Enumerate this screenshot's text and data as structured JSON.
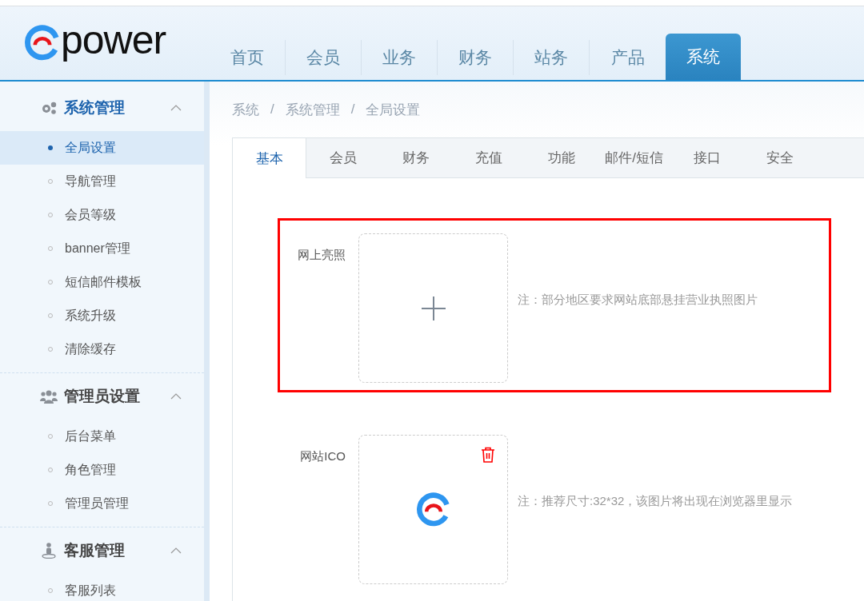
{
  "logo": {
    "text": "power"
  },
  "nav": [
    {
      "label": "首页",
      "selected": false
    },
    {
      "label": "会员",
      "selected": false
    },
    {
      "label": "业务",
      "selected": false
    },
    {
      "label": "财务",
      "selected": false
    },
    {
      "label": "站务",
      "selected": false
    },
    {
      "label": "产品",
      "selected": false
    },
    {
      "label": "系统",
      "selected": true
    }
  ],
  "sidebar": {
    "groups": [
      {
        "title": "系统管理",
        "selected": true,
        "expanded": true,
        "items": [
          {
            "label": "全局设置",
            "selected": true
          },
          {
            "label": "导航管理",
            "selected": false
          },
          {
            "label": "会员等级",
            "selected": false
          },
          {
            "label": "banner管理",
            "selected": false
          },
          {
            "label": "短信邮件模板",
            "selected": false
          },
          {
            "label": "系统升级",
            "selected": false
          },
          {
            "label": "清除缓存",
            "selected": false
          }
        ]
      },
      {
        "title": "管理员设置",
        "selected": false,
        "expanded": true,
        "items": [
          {
            "label": "后台菜单",
            "selected": false
          },
          {
            "label": "角色管理",
            "selected": false
          },
          {
            "label": "管理员管理",
            "selected": false
          }
        ]
      },
      {
        "title": "客服管理",
        "selected": false,
        "expanded": true,
        "items": [
          {
            "label": "客服列表",
            "selected": false
          }
        ]
      }
    ]
  },
  "breadcrumb": {
    "separator": "/",
    "items": [
      "系统",
      "系统管理",
      "全局设置"
    ]
  },
  "tabs": [
    {
      "label": "基本",
      "selected": true
    },
    {
      "label": "会员",
      "selected": false
    },
    {
      "label": "财务",
      "selected": false
    },
    {
      "label": "充值",
      "selected": false
    },
    {
      "label": "功能",
      "selected": false
    },
    {
      "label": "邮件/短信",
      "selected": false
    },
    {
      "label": "接口",
      "selected": false
    },
    {
      "label": "安全",
      "selected": false
    }
  ],
  "fields": [
    {
      "label": "网上亮照",
      "highlighted": true,
      "uploaded": false,
      "note": "注：部分地区要求网站底部悬挂营业执照图片"
    },
    {
      "label": "网站ICO",
      "highlighted": false,
      "uploaded": true,
      "note": "注：推荐尺寸:32*32，该图片将出现在浏览器里显示"
    }
  ]
}
